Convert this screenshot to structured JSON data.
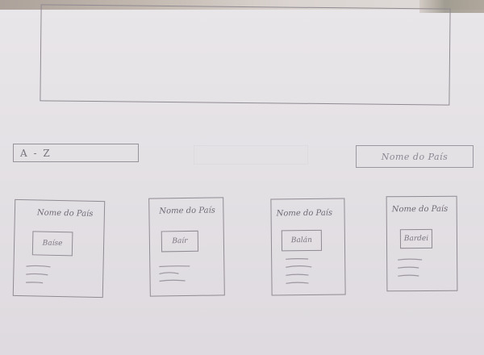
{
  "banner": {},
  "search": {
    "value": "A - Z"
  },
  "country_select": {
    "value": "Nome do País"
  },
  "cards": [
    {
      "title": "Nome do País",
      "flag": "Baíse"
    },
    {
      "title": "Nome do País",
      "flag": "Baír"
    },
    {
      "title": "Nome do País",
      "flag": "Balán"
    },
    {
      "title": "Nome do País",
      "flag": "Bardei"
    }
  ]
}
